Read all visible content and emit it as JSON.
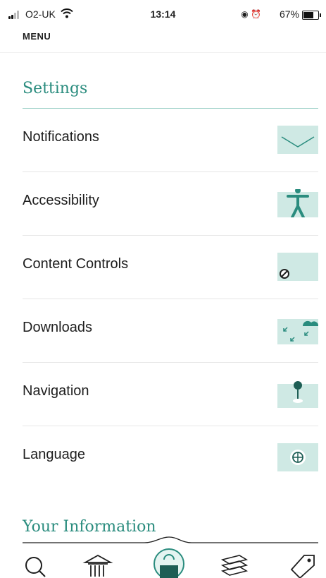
{
  "status_bar": {
    "carrier": "O2-UK",
    "time": "13:14",
    "battery_percent": "67%",
    "battery_level": 0.67
  },
  "header": {
    "menu_label": "MENU"
  },
  "settings": {
    "title": "Settings",
    "items": [
      {
        "label": "Notifications",
        "icon": "envelope-icon"
      },
      {
        "label": "Accessibility",
        "icon": "accessibility-icon"
      },
      {
        "label": "Content Controls",
        "icon": "prohibited-icon"
      },
      {
        "label": "Downloads",
        "icon": "cloud-download-icon"
      },
      {
        "label": "Navigation",
        "icon": "map-pin-icon"
      },
      {
        "label": "Language",
        "icon": "globe-icon"
      }
    ]
  },
  "your_information": {
    "title": "Your Information"
  },
  "tab_bar": {
    "tabs": [
      {
        "icon": "search-icon"
      },
      {
        "icon": "library-icon"
      },
      {
        "icon": "home-icon",
        "active": true
      },
      {
        "icon": "books-icon"
      },
      {
        "icon": "tag-icon"
      }
    ]
  },
  "colors": {
    "accent": "#2a8c7e",
    "accent_light": "#cfe9e4"
  }
}
